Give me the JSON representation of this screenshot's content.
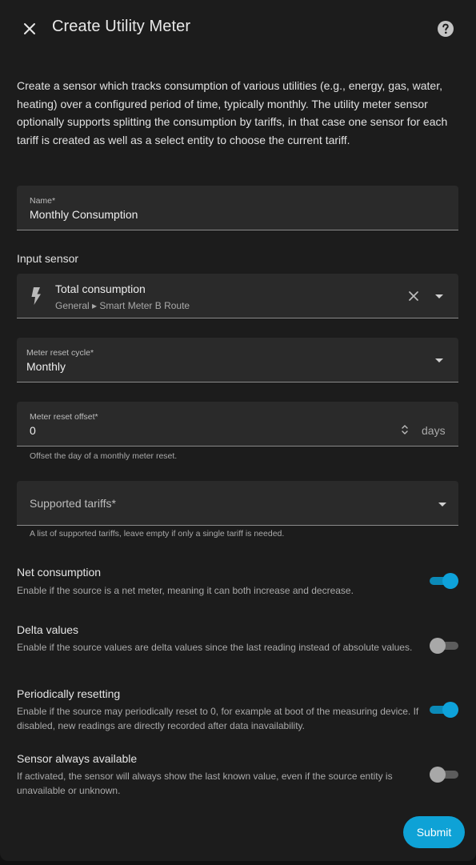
{
  "dialog": {
    "title": "Create Utility Meter",
    "close_icon": "close-icon",
    "help_icon": "help-circle-icon"
  },
  "intro": "Create a sensor which tracks consumption of various utilities (e.g., energy, gas, water, heating) over a configured period of time, typically monthly. The utility meter sensor optionally supports splitting the consumption by tariffs, in that case one sensor for each tariff is created as well as a select entity to choose the current tariff.",
  "name_field": {
    "label": "Name*",
    "value": "Monthly Consumption"
  },
  "input_sensor": {
    "section_label": "Input sensor",
    "icon": "lightning-bolt-icon",
    "title": "Total consumption",
    "subtitle": "General ▸ Smart Meter B Route"
  },
  "reset_cycle": {
    "label": "Meter reset cycle*",
    "value": "Monthly"
  },
  "reset_offset": {
    "label": "Meter reset offset*",
    "value": "0",
    "suffix": "days",
    "helper": "Offset the day of a monthly meter reset."
  },
  "tariffs": {
    "placeholder": "Supported tariffs*",
    "helper": "A list of supported tariffs, leave empty if only a single tariff is needed."
  },
  "options": [
    {
      "title": "Net consumption",
      "description": "Enable if the source is a net meter, meaning it can both increase and decrease.",
      "enabled": true
    },
    {
      "title": "Delta values",
      "description": "Enable if the source values are delta values since the last reading instead of absolute values.",
      "enabled": false
    },
    {
      "title": "Periodically resetting",
      "description": "Enable if the source may periodically reset to 0, for example at boot of the measuring device. If disabled, new readings are directly recorded after data inavailability.",
      "enabled": true
    },
    {
      "title": "Sensor always available",
      "description": "If activated, the sensor will always show the last known value, even if the source entity is unavailable or unknown.",
      "enabled": false
    }
  ],
  "submit_label": "Submit",
  "colors": {
    "accent": "#0ea2d6",
    "surface": "#1c1c1c",
    "field": "#2a2a2a"
  }
}
